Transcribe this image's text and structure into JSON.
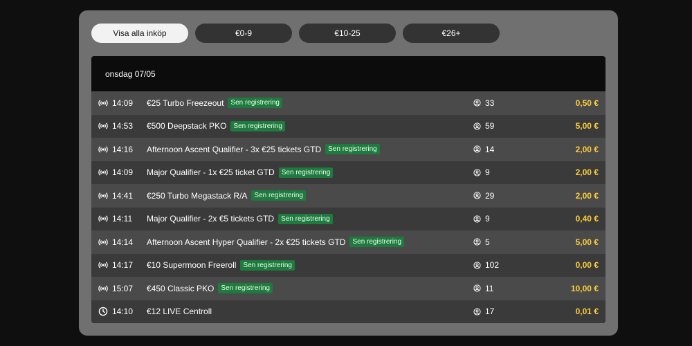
{
  "filters": [
    {
      "label": "Visa alla inköp",
      "active": true
    },
    {
      "label": "€0-9",
      "active": false
    },
    {
      "label": "€10-25",
      "active": false
    },
    {
      "label": "€26+",
      "active": false
    }
  ],
  "list": {
    "date_header": "onsdag 07/05",
    "rows": [
      {
        "icon": "live-signal-icon",
        "time": "14:09",
        "name": "€25 Turbo Freezeout",
        "badge": "Sen registrering",
        "players": "33",
        "price": "0,50 €"
      },
      {
        "icon": "live-signal-icon",
        "time": "14:53",
        "name": "€500 Deepstack PKO",
        "badge": "Sen registrering",
        "players": "59",
        "price": "5,00 €"
      },
      {
        "icon": "live-signal-icon",
        "time": "14:16",
        "name": "Afternoon Ascent Qualifier - 3x €25 tickets GTD",
        "badge": "Sen registrering",
        "players": "14",
        "price": "2,00 €"
      },
      {
        "icon": "live-signal-icon",
        "time": "14:09",
        "name": "Major Qualifier - 1x €25 ticket GTD",
        "badge": "Sen registrering",
        "players": "9",
        "price": "2,00 €"
      },
      {
        "icon": "live-signal-icon",
        "time": "14:41",
        "name": "€250 Turbo Megastack R/A",
        "badge": "Sen registrering",
        "players": "29",
        "price": "2,00 €"
      },
      {
        "icon": "live-signal-icon",
        "time": "14:11",
        "name": "Major Qualifier - 2x €5 tickets GTD",
        "badge": "Sen registrering",
        "players": "9",
        "price": "0,40 €"
      },
      {
        "icon": "live-signal-icon",
        "time": "14:14",
        "name": "Afternoon Ascent Hyper Qualifier - 2x €25 tickets GTD",
        "badge": "Sen registrering",
        "players": "5",
        "price": "5,00 €"
      },
      {
        "icon": "live-signal-icon",
        "time": "14:17",
        "name": "€10 Supermoon Freeroll",
        "badge": "Sen registrering",
        "players": "102",
        "price": "0,00 €"
      },
      {
        "icon": "live-signal-icon",
        "time": "15:07",
        "name": "€450 Classic PKO",
        "badge": "Sen registrering",
        "players": "11",
        "price": "10,00 €"
      },
      {
        "icon": "clock-icon",
        "time": "14:10",
        "name": "€12 LIVE Centroll",
        "badge": "",
        "players": "17",
        "price": "0,01 €"
      }
    ]
  },
  "colors": {
    "price": "#ffcf3a",
    "badge_bg": "#1f7a3f",
    "panel_bg": "#707070"
  }
}
